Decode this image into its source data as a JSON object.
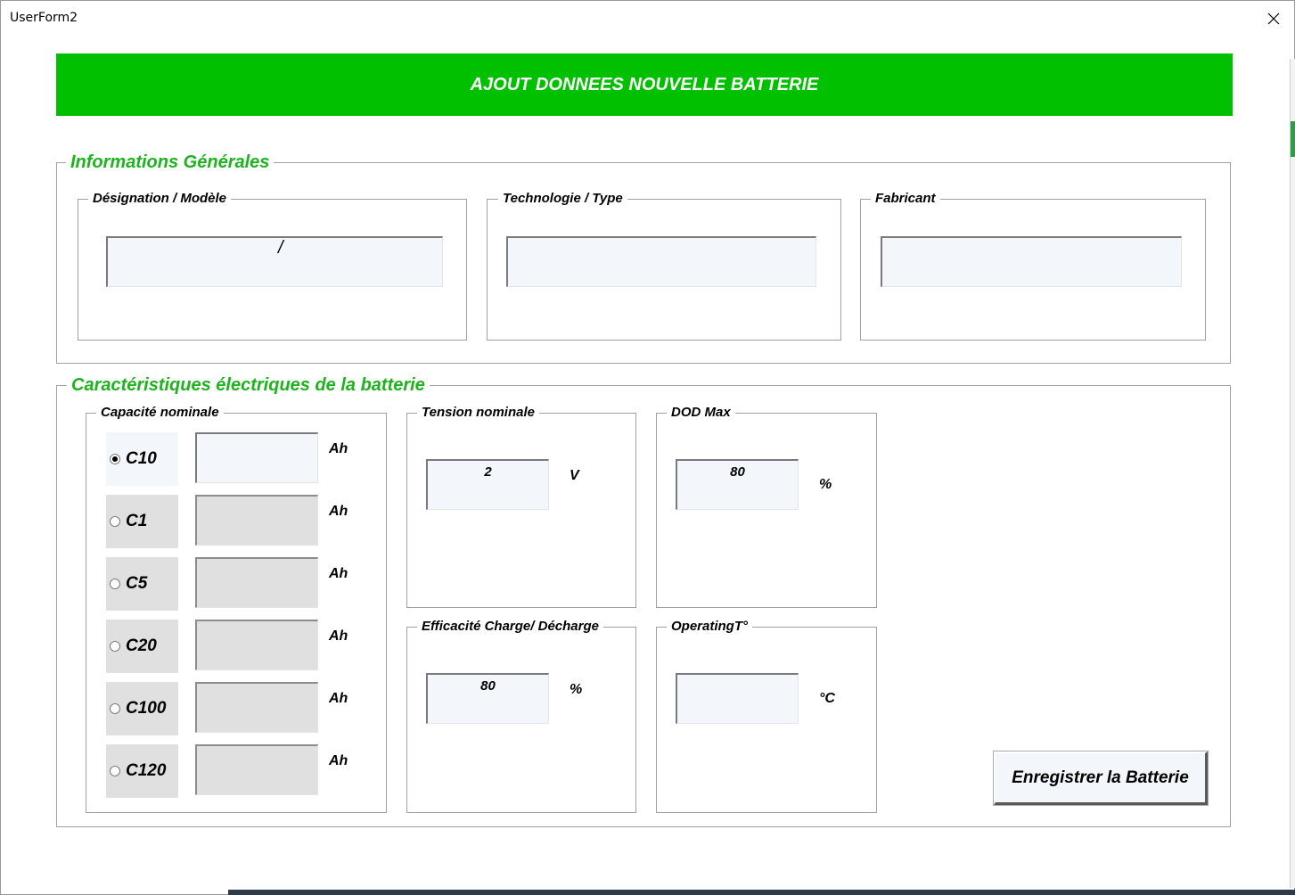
{
  "window": {
    "title": "UserForm2",
    "close_label": "✕"
  },
  "banner": {
    "title": "AJOUT DONNEES NOUVELLE BATTERIE",
    "color": "#00c000"
  },
  "general": {
    "legend": "Informations Générales",
    "designation": {
      "label": "Désignation / Modèle",
      "value": ""
    },
    "technologie": {
      "label": "Technologie / Type",
      "value": ""
    },
    "fabricant": {
      "label": "Fabricant",
      "value": ""
    }
  },
  "electrical": {
    "legend": "Caractéristiques électriques de la batterie",
    "capacity": {
      "label": "Capacité nominale",
      "unit": "Ah",
      "options": [
        {
          "label": "C10",
          "selected": true,
          "value": ""
        },
        {
          "label": "C1",
          "selected": false,
          "value": ""
        },
        {
          "label": "C5",
          "selected": false,
          "value": ""
        },
        {
          "label": "C20",
          "selected": false,
          "value": ""
        },
        {
          "label": "C100",
          "selected": false,
          "value": ""
        },
        {
          "label": "C120",
          "selected": false,
          "value": ""
        }
      ]
    },
    "tension": {
      "label": "Tension nominale",
      "value": "2",
      "unit": "V"
    },
    "dod": {
      "label": "DOD Max",
      "value": "80",
      "unit": "%"
    },
    "efficacite": {
      "label": "Efficacité Charge/ Décharge",
      "value": "80",
      "unit": "%"
    },
    "operating": {
      "label": "OperatingT°",
      "value": "",
      "unit": "°C"
    }
  },
  "actions": {
    "save_label": "Enregistrer la Batterie"
  },
  "colors": {
    "accent": "#00c000",
    "legend_green": "#1db31d",
    "input_bg": "#f3f6fb",
    "disabled_bg": "#e0e0e0"
  }
}
